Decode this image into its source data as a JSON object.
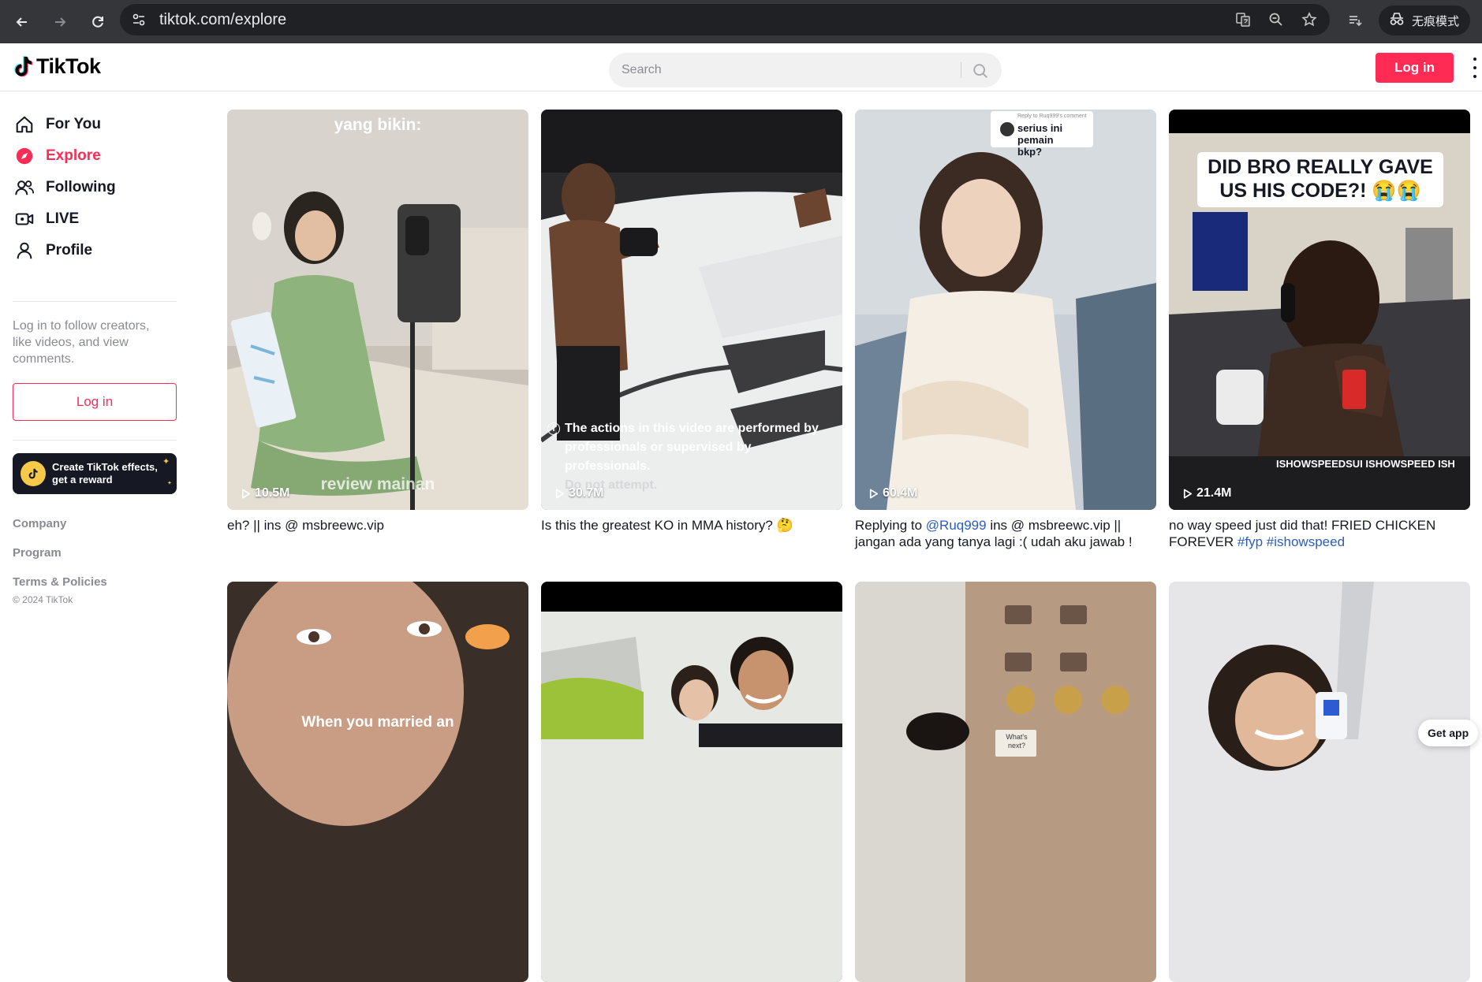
{
  "browser": {
    "url": "tiktok.com/explore",
    "incognito_label": "无痕模式"
  },
  "header": {
    "logo_text": "TikTok",
    "search_placeholder": "Search",
    "login_label": "Log in"
  },
  "sidebar": {
    "items": [
      {
        "label": "For You",
        "icon": "home-icon",
        "active": false
      },
      {
        "label": "Explore",
        "icon": "compass-icon",
        "active": true
      },
      {
        "label": "Following",
        "icon": "following-icon",
        "active": false
      },
      {
        "label": "LIVE",
        "icon": "live-icon",
        "active": false
      },
      {
        "label": "Profile",
        "icon": "profile-icon",
        "active": false
      }
    ],
    "login_note": "Log in to follow creators, like videos, and view comments.",
    "login_label": "Log in",
    "effects_line1": "Create TikTok effects,",
    "effects_line2": "get a reward",
    "footer": {
      "company": "Company",
      "program": "Program",
      "terms": "Terms & Policies",
      "copyright": "© 2024 TikTok"
    }
  },
  "videos": [
    {
      "views": "10.5M",
      "overlay_top": "yang bikin:",
      "overlay_bottom": "review mainan",
      "caption": "eh? || ins @ msbreewc.vip"
    },
    {
      "views": "30.7M",
      "warning_line1": "The actions in this video are performed by",
      "warning_line2": "professionals or supervised by professionals.",
      "warning_line3": "Do not attempt.",
      "caption": "Is this the greatest KO in MMA history? 🤔"
    },
    {
      "views": "60.4M",
      "reply_header": "Reply to Ruq999's comment",
      "reply_text_1": "serius ini pemain",
      "reply_text_2": "bkp?",
      "caption_pre": "Replying to ",
      "caption_mention": "@Ruq999",
      "caption_post": " ins @ msbreewc.vip ||",
      "caption_line2": "jangan ada yang tanya lagi :( udah aku jawab !"
    },
    {
      "views": "21.4M",
      "overlay_line1": "DID BRO REALLY GAVE",
      "overlay_line2": "US HIS CODE?! 😭😭",
      "watermark": "ISHOWSPEEDSUI  ISHOWSPEED  ISH",
      "caption_pre": "no way speed just did that! FRIED CHICKEN",
      "caption_line2_pre": "FOREVER ",
      "tag1": "#fyp",
      "tag2": "#ishowspeed"
    },
    {
      "overlay_bottom": "When you married an"
    },
    {},
    {
      "sign_text": "What's next?"
    },
    {}
  ],
  "get_app_label": "Get app",
  "colors": {
    "brand": "#fe2c55",
    "link": "#2b5db9",
    "chrome": "#35363a"
  }
}
